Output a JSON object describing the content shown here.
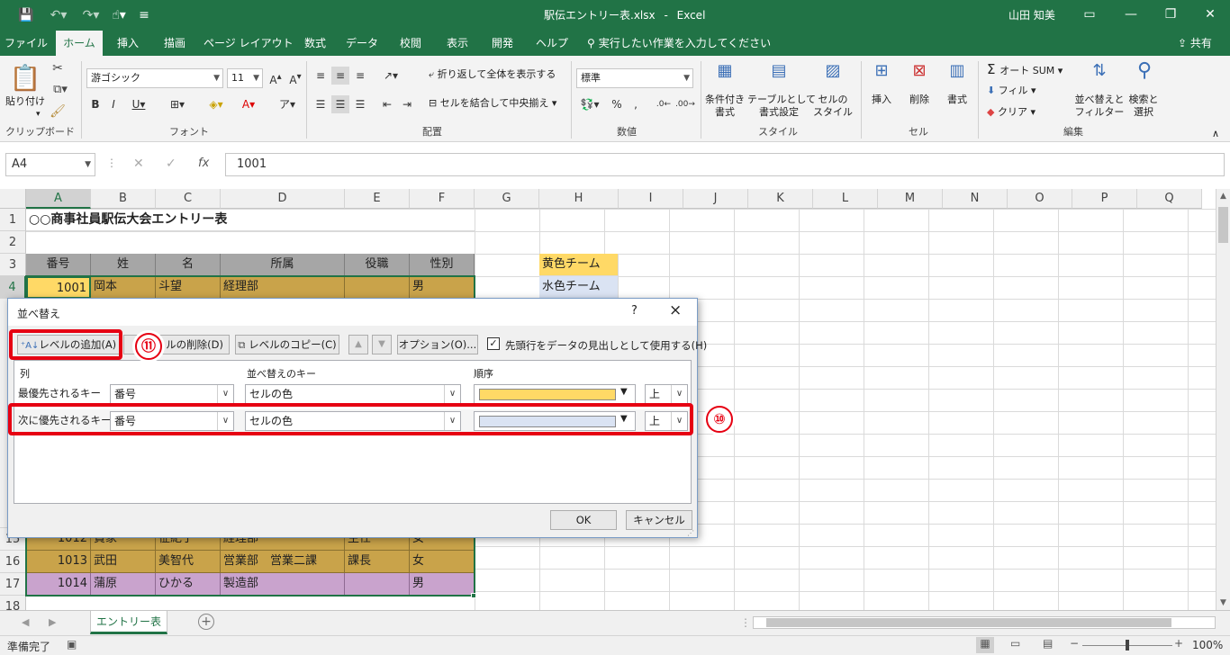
{
  "titlebar": {
    "filename": "駅伝エントリー表.xlsx",
    "sep": "-",
    "app": "Excel",
    "user": "山田 知美"
  },
  "tabs": [
    "ファイル",
    "ホーム",
    "挿入",
    "描画",
    "ページ レイアウト",
    "数式",
    "データ",
    "校閲",
    "表示",
    "開発",
    "ヘルプ"
  ],
  "tell_me": "実行したい作業を入力してください",
  "share": "共有",
  "ribbon": {
    "clipboard": {
      "label": "クリップボード",
      "paste": "貼り付け"
    },
    "font": {
      "label": "フォント",
      "name": "游ゴシック",
      "size": "11"
    },
    "alignment": {
      "label": "配置",
      "wrap": "折り返して全体を表示する",
      "merge": "セルを結合して中央揃え"
    },
    "number": {
      "label": "数値",
      "format": "標準"
    },
    "styles": {
      "label": "スタイル",
      "conditional": "条件付き",
      "conditional2": "書式",
      "table": "テーブルとして",
      "table2": "書式設定",
      "cell": "セルの",
      "cell2": "スタイル"
    },
    "cells": {
      "label": "セル",
      "insert": "挿入",
      "delete": "削除",
      "format": "書式"
    },
    "editing": {
      "label": "編集",
      "autosum": "オート SUM",
      "fill": "フィル",
      "clear": "クリア",
      "sort": "並べ替えと",
      "sort2": "フィルター",
      "find": "検索と",
      "find2": "選択"
    }
  },
  "formula_bar": {
    "name_box": "A4",
    "value": "1001"
  },
  "columns": [
    "A",
    "B",
    "C",
    "D",
    "E",
    "F",
    "G",
    "H",
    "I",
    "J",
    "K",
    "L",
    "M",
    "N",
    "O",
    "P",
    "Q"
  ],
  "rows": [
    "1",
    "2",
    "3",
    "4",
    "15",
    "16",
    "17",
    "18"
  ],
  "sheet": {
    "title": "○○商事社員駅伝大会エントリー表",
    "headers": [
      "番号",
      "姓",
      "名",
      "所属",
      "役職",
      "性別"
    ],
    "row4": [
      "1001",
      "岡本",
      "斗望",
      "経理部",
      "",
      "男"
    ],
    "row15": [
      "1012",
      "貴家",
      "征紀子",
      "経理部",
      "主任",
      "女"
    ],
    "row16": [
      "1013",
      "武田",
      "美智代",
      "営業部　営業二課",
      "課長",
      "女"
    ],
    "row17": [
      "1014",
      "蒲原",
      "ひかる",
      "製造部",
      "",
      "男"
    ],
    "team_yellow": "黄色チーム",
    "team_blue": "水色チーム"
  },
  "colors": {
    "excel_green": "#217346",
    "header_gray": "#a6a6a6",
    "yellow_fill": "#ffd966",
    "gold_row": "#c9a34a",
    "purple_row": "#c9a3cd",
    "blue_fill": "#dae3f3",
    "highlight_red": "#e60012"
  },
  "dialog": {
    "title": "並べ替え",
    "help": "?",
    "close": "×",
    "add_level": "レベルの追加(A)",
    "delete_level": "ルの削除(D)",
    "copy_level": "レベルのコピー(C)",
    "up": "▲",
    "down": "▼",
    "options": "オプション(O)...",
    "header_checkbox": "先頭行をデータの見出しとして使用する(H)",
    "col_header": "列",
    "key_header": "並べ替えのキー",
    "order_header": "順序",
    "levels": [
      {
        "label": "最優先されるキー",
        "column": "番号",
        "key": "セルの色",
        "color": "#ffd966",
        "position": "上"
      },
      {
        "label": "次に優先されるキー",
        "column": "番号",
        "key": "セルの色",
        "color": "#dae3f3",
        "position": "上"
      }
    ],
    "ok": "OK",
    "cancel": "キャンセル"
  },
  "annotations": {
    "step10": "⑩",
    "step11": "⑪"
  },
  "sheet_tab": "エントリー表",
  "status": {
    "ready": "準備完了",
    "zoom": "100%"
  }
}
